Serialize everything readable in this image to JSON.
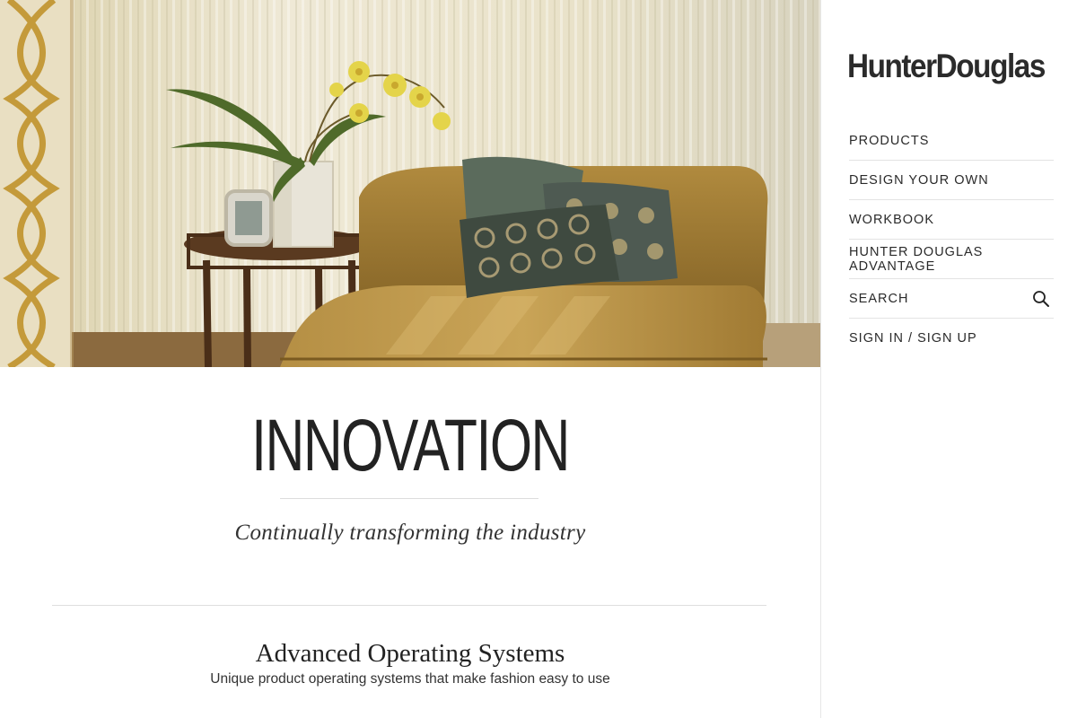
{
  "brand": {
    "logo": "HunterDouglas"
  },
  "nav": {
    "items": [
      {
        "label": "PRODUCTS"
      },
      {
        "label": "DESIGN YOUR OWN"
      },
      {
        "label": "WORKBOOK"
      },
      {
        "label": "HUNTER DOUGLAS ADVANTAGE"
      },
      {
        "label": "SEARCH",
        "icon": "search-icon"
      },
      {
        "label": "SIGN IN / SIGN UP"
      }
    ]
  },
  "hero": {
    "title": "INNOVATION",
    "tagline": "Continually transforming the industry"
  },
  "section": {
    "title": "Advanced Operating Systems",
    "subtitle": "Unique product operating systems that make fashion easy to use"
  }
}
